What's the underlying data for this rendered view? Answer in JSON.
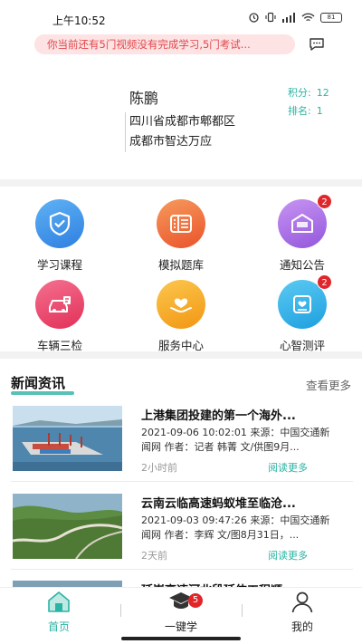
{
  "status": {
    "time": "上午10:52",
    "battery": "81"
  },
  "notice": {
    "text": "你当前还有5门视频没有完成学习,5门考试..."
  },
  "profile": {
    "name": "陈鹏",
    "address_line1": "四川省成都市郫都区",
    "address_line2": "成都市智达万应",
    "score_label": "积分:",
    "score_value": "12",
    "rank_label": "排名:",
    "rank_value": "1"
  },
  "grid": [
    {
      "label": "学习课程",
      "icon": "shield-check-icon",
      "color": "#3a8ee8",
      "badge": ""
    },
    {
      "label": "模拟题库",
      "icon": "question-bank-icon",
      "color": "#ef6a35",
      "badge": ""
    },
    {
      "label": "通知公告",
      "icon": "notice-envelope-icon",
      "color": "#a46be0",
      "badge": "2"
    },
    {
      "label": "车辆三检",
      "icon": "car-inspection-icon",
      "color": "#ea3f66",
      "badge": ""
    },
    {
      "label": "服务中心",
      "icon": "heart-hand-icon",
      "color": "#f5a218",
      "badge": ""
    },
    {
      "label": "心智测评",
      "icon": "heart-assessment-icon",
      "color": "#2bb0e8",
      "badge": "2"
    }
  ],
  "news": {
    "title": "新闻资讯",
    "more": "查看更多",
    "items": [
      {
        "headline": "上港集团投建的第一个海外...",
        "meta": "2021-09-06 10:02:01 来源：中国交通新闻网 作者：记者 韩菁 文/供图9月...",
        "time": "2小时前",
        "read": "阅读更多"
      },
      {
        "headline": "云南云临高速蚂蚁堆至临沧...",
        "meta": "2021-09-03 09:47:26 来源：中国交通新闻网 作者：李辉 文/图8月31日，...",
        "time": "2天前",
        "read": "阅读更多"
      },
      {
        "headline": "延崇高速河北段延伸工程顺...",
        "meta": "",
        "time": "",
        "read": ""
      }
    ]
  },
  "tabbar": {
    "home": "首页",
    "study": "一键学",
    "study_badge": "5",
    "mine": "我的",
    "active_color": "#2bb3a3"
  }
}
